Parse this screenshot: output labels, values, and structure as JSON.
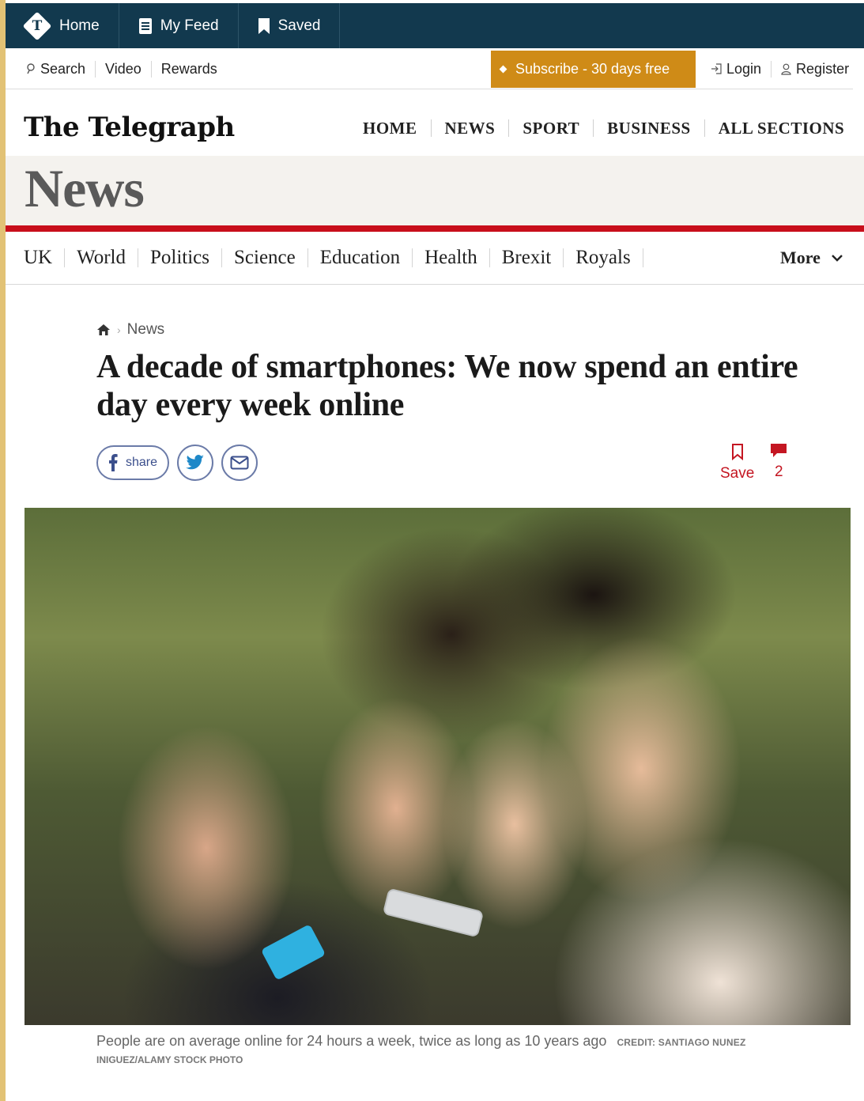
{
  "topbar": {
    "home_label": "Home",
    "myfeed_label": "My Feed",
    "saved_label": "Saved"
  },
  "utility": {
    "search_label": "Search",
    "video_label": "Video",
    "rewards_label": "Rewards",
    "subscribe_label": "Subscribe - 30 days free",
    "login_label": "Login",
    "register_label": "Register",
    "subscribe_color": "#cf8b17"
  },
  "masthead": {
    "brand": "The Telegraph",
    "nav": [
      "HOME",
      "NEWS",
      "SPORT",
      "BUSINESS",
      "ALL SECTIONS"
    ]
  },
  "section": {
    "title": "News",
    "accent_color": "#c80f1b"
  },
  "subnav": {
    "items": [
      "UK",
      "World",
      "Politics",
      "Science",
      "Education",
      "Health",
      "Brexit",
      "Royals"
    ],
    "more_label": "More"
  },
  "article": {
    "breadcrumb": "News",
    "headline": "A decade of smartphones: We now spend an entire day every week online",
    "share_label": "share",
    "save_label": "Save",
    "comment_count": "2",
    "caption": "People are on average online for 24 hours a week, twice as long as 10 years ago",
    "credit_a": "CREDIT: SANTIAGO NUNEZ",
    "credit_b": "INIGUEZ/ALAMY STOCK PHOTO"
  },
  "icons": [
    "telegraph-logo-icon",
    "feed-icon",
    "bookmark-icon",
    "search-icon",
    "login-icon",
    "user-icon",
    "home-icon",
    "chevron-down-icon",
    "facebook-icon",
    "twitter-icon",
    "email-icon",
    "comment-icon"
  ]
}
